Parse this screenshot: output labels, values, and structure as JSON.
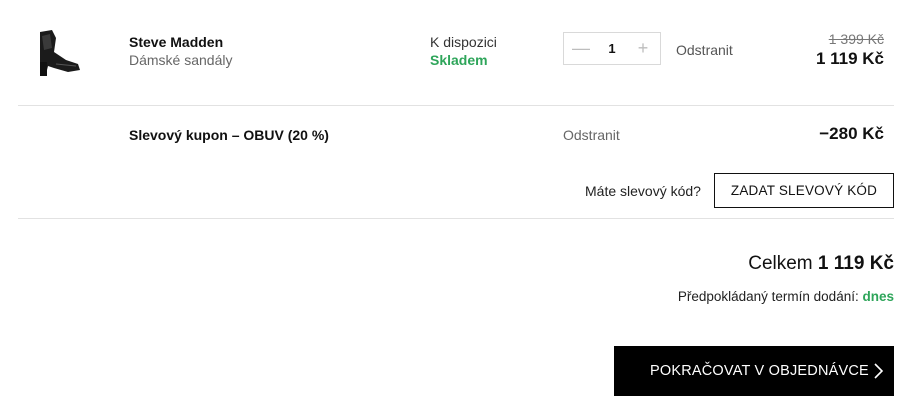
{
  "product": {
    "brand": "Steve Madden",
    "type": "Dámské sandály",
    "image_icon": "sandal-image",
    "availability_label": "K dispozici",
    "availability_status": "Skladem",
    "quantity": "1",
    "minus_symbol": "—",
    "plus_symbol": "+",
    "remove_label": "Odstranit",
    "price_old": "1 399 Kč",
    "price_new": "1 119 Kč"
  },
  "coupon": {
    "label": "Slevový kupon – OBUV (20 %)",
    "remove_label": "Odstranit",
    "amount": "−280 Kč"
  },
  "discount": {
    "question": "Máte slevový kód?",
    "button_label": "ZADAT SLEVOVÝ KÓD"
  },
  "summary": {
    "total_label": "Celkem",
    "total_value": "1 119 Kč",
    "delivery_label": "Předpokládaný termín dodání:",
    "delivery_value": "dnes"
  },
  "continue": {
    "label": "POKRAČOVAT V OBJEDNÁVCE",
    "icon": "chevron-right-icon"
  },
  "colors": {
    "accent_green": "#2ea55a",
    "button_black": "#000000",
    "divider": "#e2e2e2"
  }
}
